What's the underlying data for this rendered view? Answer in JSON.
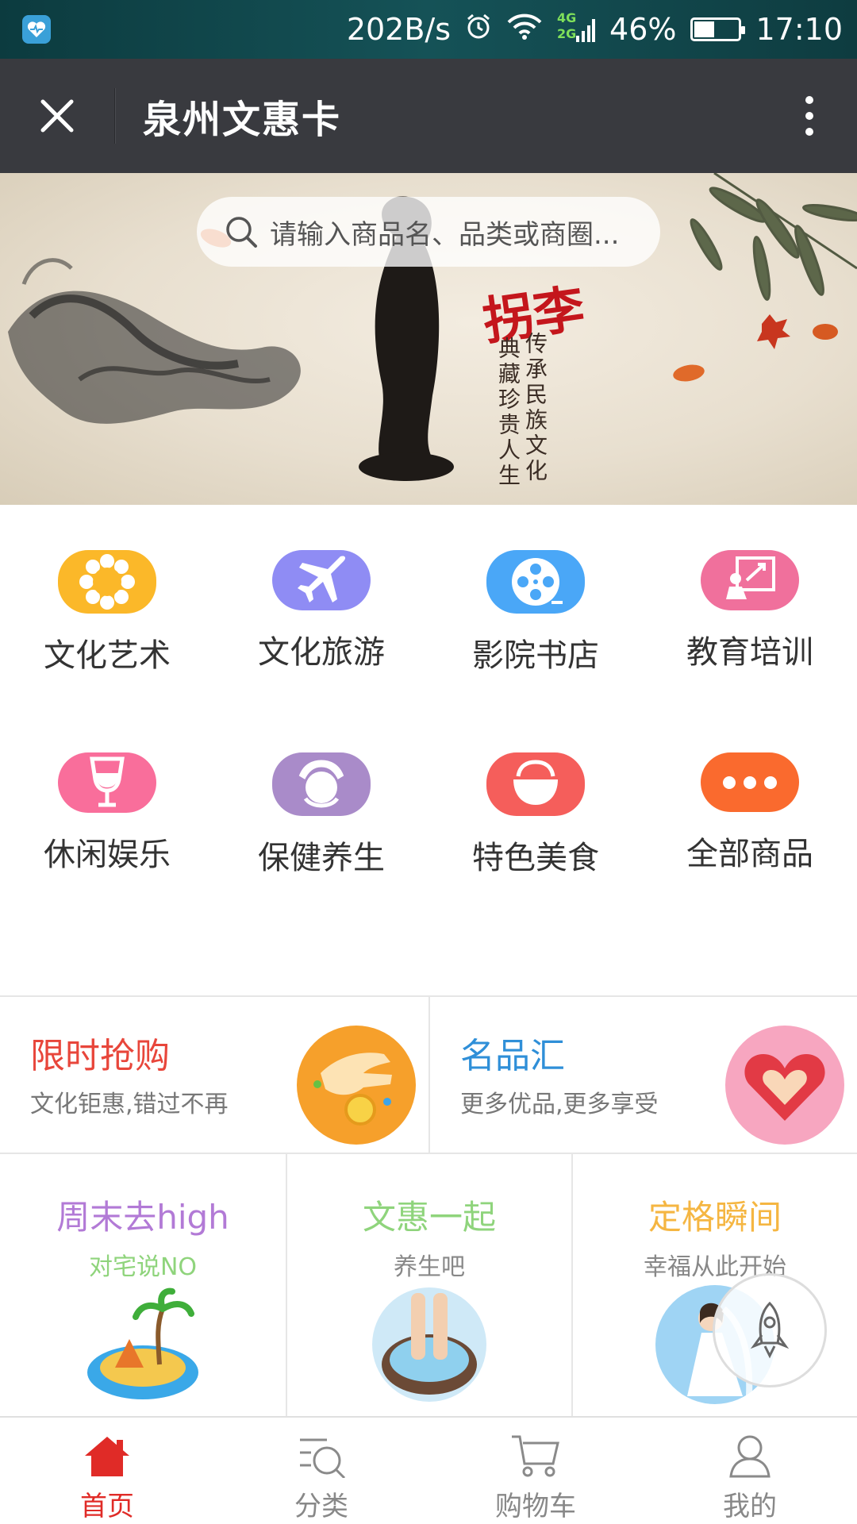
{
  "status_bar": {
    "net_speed": "202B/s",
    "network_top": "4G",
    "network_bottom": "2G",
    "battery": "46%",
    "battery_level": 0.46,
    "time": "17:10"
  },
  "nav": {
    "title": "泉州文惠卡"
  },
  "banner": {
    "search_placeholder": "请输入商品名、品类或商圈...",
    "brand_text": "拐李",
    "slogan_line1": "传承民族文化",
    "slogan_line2": "典藏珍贵人生"
  },
  "categories": [
    {
      "label": "文化艺术",
      "icon": "flower-ring-icon",
      "color": "#fbb829"
    },
    {
      "label": "文化旅游",
      "icon": "airplane-icon",
      "color": "#8f8cf4"
    },
    {
      "label": "影院书店",
      "icon": "film-reel-icon",
      "color": "#4aa7f7"
    },
    {
      "label": "教育培训",
      "icon": "blackboard-teacher-icon",
      "color": "#f0709c"
    },
    {
      "label": "休闲娱乐",
      "icon": "wine-glass-icon",
      "color": "#f96e9b"
    },
    {
      "label": "保健养生",
      "icon": "massage-hands-icon",
      "color": "#a98bc9"
    },
    {
      "label": "特色美食",
      "icon": "bowl-icon",
      "color": "#f55e5b"
    },
    {
      "label": "全部商品",
      "icon": "more-dots-icon",
      "color": "#fa6a2e"
    }
  ],
  "promos": [
    {
      "title": "限时抢购",
      "subtitle": "文化钜惠,错过不再",
      "title_color": "#e8463b",
      "image": "hand-coin-icon"
    },
    {
      "title": "名品汇",
      "subtitle": "更多优品,更多享受",
      "title_color": "#2f8fd8",
      "image": "heart-hands-icon"
    }
  ],
  "features": [
    {
      "title": "周末去high",
      "subtitle": "对宅说NO",
      "title_color": "#b27ad6",
      "subtitle_color": "#8fd47c",
      "image": "island-icon"
    },
    {
      "title": "文惠一起",
      "subtitle": "养生吧",
      "title_color": "#8fd47c",
      "subtitle_color": "#888888",
      "image": "foot-spa-icon"
    },
    {
      "title": "定格瞬间",
      "subtitle": "幸福从此开始",
      "title_color": "#f5b642",
      "subtitle_color": "#888888",
      "image": "bride-icon"
    }
  ],
  "tabs": [
    {
      "label": "首页",
      "icon": "home-icon",
      "active": true
    },
    {
      "label": "分类",
      "icon": "category-search-icon",
      "active": false
    },
    {
      "label": "购物车",
      "icon": "cart-icon",
      "active": false
    },
    {
      "label": "我的",
      "icon": "user-icon",
      "active": false
    }
  ],
  "colors": {
    "nav_bg": "#393a3f",
    "accent_red": "#e02b27"
  }
}
